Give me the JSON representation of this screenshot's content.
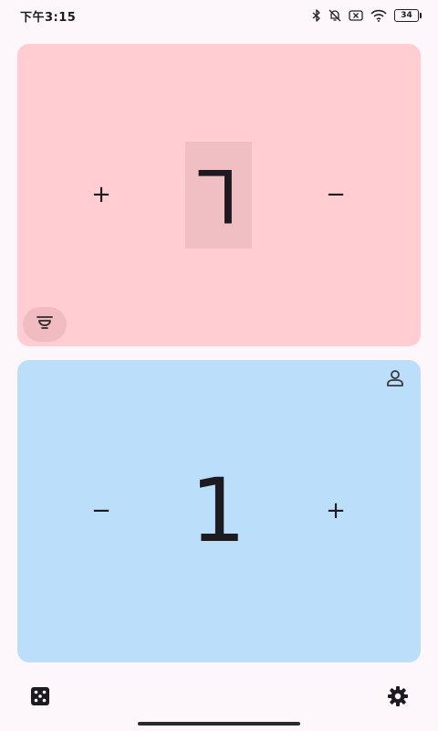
{
  "status_bar": {
    "time": "下午3:15",
    "battery_level": "34",
    "icons": [
      "bluetooth-icon",
      "bell-off-icon",
      "sim-x-icon",
      "wifi-icon",
      "battery-icon"
    ]
  },
  "players": [
    {
      "id": "top",
      "life": "L",
      "rotated": true,
      "background": "#ffcdd2",
      "left_button": "+",
      "right_button": "−"
    },
    {
      "id": "bottom",
      "life": "1",
      "rotated": false,
      "background": "#bbdefb",
      "left_button": "−",
      "right_button": "+"
    }
  ],
  "toolbar": {
    "dice_icon": "dice-icon",
    "settings_icon": "gear-icon"
  },
  "colors": {
    "page_background": "#fdf7fc",
    "top_panel": "#ffcdd2",
    "bottom_panel": "#bbdefb"
  }
}
